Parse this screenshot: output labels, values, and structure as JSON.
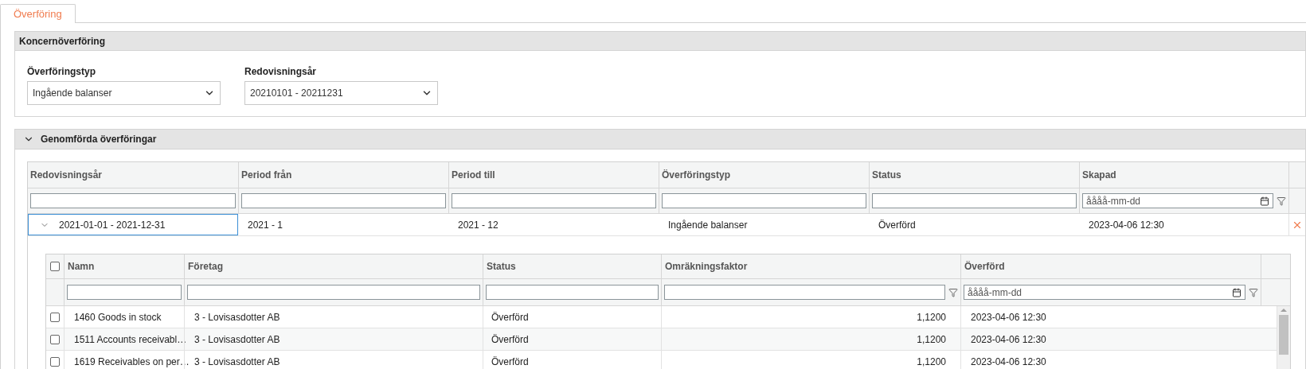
{
  "tabs": [
    {
      "label": "Överföring",
      "selected": true
    }
  ],
  "group_transfer": {
    "title": "Koncernöverföring",
    "fields": [
      {
        "label": "Överföringstyp",
        "value": "Ingående balanser"
      },
      {
        "label": "Redovisningsår",
        "value": "20210101 - 20211231"
      }
    ]
  },
  "completed": {
    "title": "Genomförda överföringar",
    "expanded": true,
    "table": {
      "columns": [
        {
          "label": "Redovisningsår",
          "kind": "text"
        },
        {
          "label": "Period från",
          "kind": "text"
        },
        {
          "label": "Period till",
          "kind": "text"
        },
        {
          "label": "Överföringstyp",
          "kind": "text"
        },
        {
          "label": "Status",
          "kind": "text"
        },
        {
          "label": "Skapad",
          "kind": "date",
          "placeholder": "åååå-mm-dd"
        }
      ],
      "rows": [
        {
          "expanded": true,
          "selected": true,
          "cells": [
            "2021-01-01 - 2021-12-31",
            "2021 - 1",
            "2021 - 12",
            "Ingående balanser",
            "Överförd",
            "2023-04-06 12:30"
          ],
          "detail": {
            "all_checked": false,
            "columns": [
              {
                "label": "Namn",
                "kind": "text"
              },
              {
                "label": "Företag",
                "kind": "text"
              },
              {
                "label": "Status",
                "kind": "text"
              },
              {
                "label": "Omräkningsfaktor",
                "kind": "funnel"
              },
              {
                "label": "Överförd",
                "kind": "date",
                "placeholder": "åååå-mm-dd"
              }
            ],
            "rows": [
              {
                "checked": false,
                "cells": [
                  "1460 Goods in stock",
                  "3 - Lovisasdotter AB",
                  "Överförd",
                  "1,1200",
                  "2023-04-06 12:30"
                ]
              },
              {
                "checked": false,
                "cells": [
                  "1511 Accounts receivabl…",
                  "3 - Lovisasdotter AB",
                  "Överförd",
                  "1,1200",
                  "2023-04-06 12:30"
                ]
              },
              {
                "checked": false,
                "cells": [
                  "1619 Receivables on per…",
                  "3 - Lovisasdotter AB",
                  "Överförd",
                  "1,1200",
                  "2023-04-06 12:30"
                ]
              }
            ]
          }
        }
      ]
    }
  }
}
